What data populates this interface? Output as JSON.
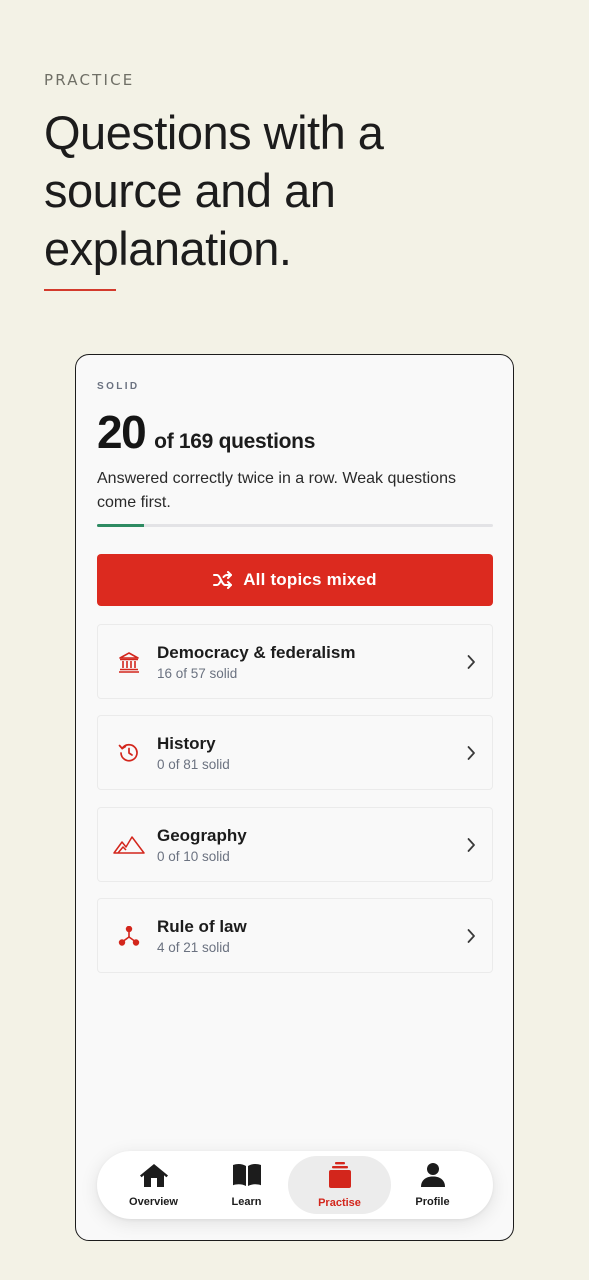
{
  "header": {
    "eyebrow": "PRACTICE",
    "headline": "Questions with a source and an explanation."
  },
  "summary": {
    "label": "SOLID",
    "solid_count": "20",
    "total_text": "of 169 questions",
    "description": "Answered correctly twice in a row. Weak questions come first.",
    "progress_fraction": 0.118
  },
  "mix_button": {
    "label": "All topics mixed",
    "icon": "shuffle-icon"
  },
  "topics": [
    {
      "title": "Democracy & federalism",
      "subtitle": "16 of 57 solid",
      "icon": "institution-icon"
    },
    {
      "title": "History",
      "subtitle": "0 of 81 solid",
      "icon": "history-icon"
    },
    {
      "title": "Geography",
      "subtitle": "0 of 10 solid",
      "icon": "mountains-icon"
    },
    {
      "title": "Rule of law",
      "subtitle": "4 of 21 solid",
      "icon": "nodes-icon"
    }
  ],
  "nav": {
    "items": [
      {
        "label": "Overview",
        "icon": "home-icon"
      },
      {
        "label": "Learn",
        "icon": "book-icon"
      },
      {
        "label": "Practise",
        "icon": "stack-icon",
        "active": true
      },
      {
        "label": "Profile",
        "icon": "person-icon"
      }
    ]
  },
  "colors": {
    "background": "#f3f2e6",
    "accent": "#dc2a1f",
    "progress": "#2e8b62",
    "muted": "#6b7280"
  }
}
